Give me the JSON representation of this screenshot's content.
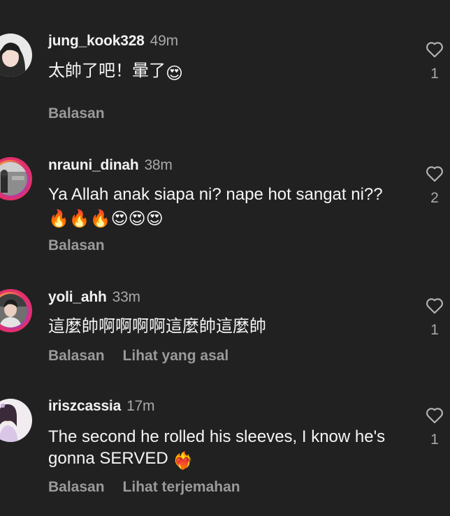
{
  "comments": [
    {
      "username": "jung_kook328",
      "time": "49m",
      "text": "太帥了吧！暈了",
      "emoji": "😍",
      "like_count": "1",
      "actions": [
        "Balasan"
      ]
    },
    {
      "username": "nrauni_dinah",
      "time": "38m",
      "text": "Ya Allah anak siapa ni? nape hot sangat ni??",
      "emoji": "🔥🔥🔥😍😍😍",
      "like_count": "2",
      "actions": [
        "Balasan"
      ]
    },
    {
      "username": "yoli_ahh",
      "time": "33m",
      "text": "這麼帥啊啊啊啊這麼帥這麼帥",
      "emoji": "",
      "like_count": "1",
      "actions": [
        "Balasan",
        "Lihat yang asal"
      ]
    },
    {
      "username": "iriszcassia",
      "time": "17m",
      "text": "The second he rolled his sleeves, I know he's gonna SERVED",
      "emoji": "❤️‍🔥",
      "like_count": "1",
      "actions": [
        "Balasan",
        "Lihat terjemahan"
      ]
    }
  ],
  "icons": {
    "like": "heart-outline-icon"
  },
  "colors": {
    "background": "#212121",
    "text": "#f5f5f5",
    "muted": "#9a9a9a",
    "story_ring": "#e1306c"
  }
}
